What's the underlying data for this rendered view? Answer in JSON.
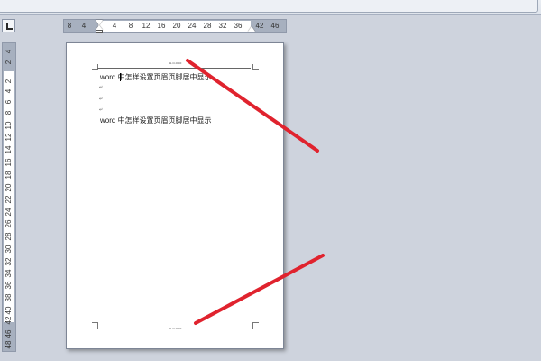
{
  "ruler": {
    "horizontal_labels": [
      "8",
      "4",
      "4",
      "8",
      "12",
      "16",
      "20",
      "24",
      "28",
      "32",
      "36",
      "42",
      "46"
    ],
    "vertical_labels": [
      "4",
      "2",
      "2",
      "4",
      "6",
      "8",
      "10",
      "12",
      "14",
      "16",
      "18",
      "20",
      "22",
      "24",
      "26",
      "28",
      "30",
      "32",
      "34",
      "36",
      "38",
      "40",
      "42",
      "46",
      "48"
    ]
  },
  "document": {
    "header_text": "ш.о.ооо",
    "lines": [
      "word 中怎样设置页眉页脚居中显示",
      "word 中怎样设置页眉页脚居中显示"
    ],
    "paragraph_marks": [
      "↵",
      "↵",
      "↵"
    ],
    "footer_text": "ш.о.ооо"
  },
  "annotation": {
    "color": "#e0232e"
  }
}
